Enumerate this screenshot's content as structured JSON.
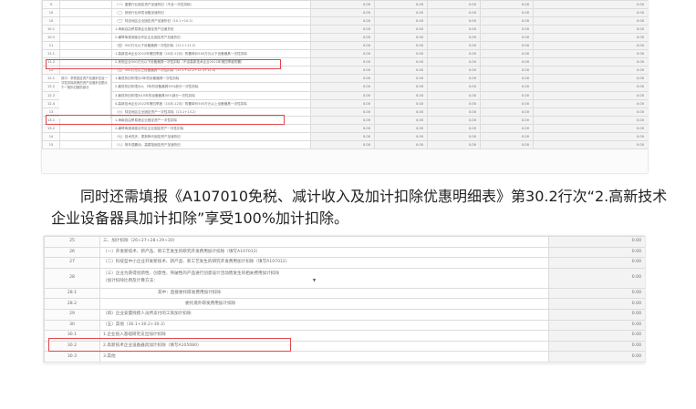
{
  "table1": {
    "merged_label": "其中：享受固定资产加速折旧及一次性扣除政策的资产加速折旧额大于一般折旧额的部分",
    "rows": [
      {
        "num": "9",
        "name": "（一）重要行业固定资产加速折旧（不含一次性扣除）",
        "v": [
          "0.00",
          "0.00",
          "0.00",
          "0.00",
          "0.00"
        ]
      },
      {
        "num": "10",
        "name": "（二）其他行业研发设备加速折旧",
        "v": [
          "0.00",
          "0.00",
          "0.00",
          "0.00",
          "0.00"
        ]
      },
      {
        "num": "10",
        "name": "（三）特定地区企业固定资产加速折旧（10.1+10.2）",
        "v": [
          "0.00",
          "0.00",
          "0.00",
          "0.00",
          "0.00"
        ]
      },
      {
        "num": "10.1",
        "name": "1.海南自由贸易港企业固定资产加速折旧",
        "v": [
          "0.00",
          "0.00",
          "0.00",
          "0.00",
          "0.00"
        ]
      },
      {
        "num": "10.2",
        "name": "2.横琴粤澳深度合作区企业固定资产加速折旧",
        "v": [
          "0.00",
          "0.00",
          "0.00",
          "0.00",
          "0.00"
        ]
      },
      {
        "num": "11",
        "name": "（四）500万元以下设备器具一次性扣除（11.1+11.2）",
        "v": [
          "0.00",
          "0.00",
          "0.00",
          "0.00",
          "0.00"
        ]
      },
      {
        "num": "11.1",
        "name": "1.高新技术企业2022年第四季度（10月-12月）购置单价500万元以下设备器具一次性扣除",
        "v": [
          "0.00",
          "0.00",
          "0.00",
          "0.00",
          "0.00"
        ]
      },
      {
        "num": "11.2",
        "name": "2.其他企业500万元以下设备器具一次性扣除（不含高新技术企业2022年第四季度购置）",
        "v": [
          "0.00",
          "0.00",
          "0.00",
          "0.00",
          "0.00"
        ]
      },
      {
        "num": "12",
        "name": "（五）500万元以上设备器具一次性扣除（12.1+12.2+12.3+12.4）",
        "v": [
          "0.00",
          "0.00",
          "0.00",
          "0.00",
          "0.00"
        ]
      },
      {
        "num": "12.1",
        "name": "1.最低折旧年限为3年的设备器具一次性扣除",
        "v": [
          "0.00",
          "0.00",
          "0.00",
          "0.00",
          "0.00"
        ]
      },
      {
        "num": "12.2",
        "name": "2.最低折旧年限为4、5年的设备器具50%部分一次性扣除",
        "v": [
          "0.00",
          "0.00",
          "0.00",
          "0.00",
          "0.00"
        ]
      },
      {
        "num": "12.3",
        "name": "3.最低折旧年限为10年的设备器具50%部分一次性扣除",
        "v": [
          "0.00",
          "0.00",
          "0.00",
          "0.00",
          "0.00"
        ]
      },
      {
        "num": "12.4",
        "name": "4.高新技术企业2022年第四季度（10月-12月）购置单价500万元以上设备器具一次性扣除",
        "v": [
          "0.00",
          "0.00",
          "0.00",
          "0.00",
          "0.00"
        ]
      },
      {
        "num": "13",
        "name": "（六）特定地区企业固定资产一次性扣除（13.1+13.2）",
        "v": [
          "0.00",
          "0.00",
          "0.00",
          "0.00",
          "0.00"
        ]
      },
      {
        "num": "13.1",
        "name": "1.海南自由贸易港企业固定资产一次性扣除",
        "v": [
          "0.00",
          "0.00",
          "0.00",
          "0.00",
          "0.00"
        ]
      },
      {
        "num": "13.2",
        "name": "2.横琴粤澳深度合作区企业固定资产一次性扣除",
        "v": [
          "0.00",
          "0.00",
          "0.00",
          "0.00",
          "0.00"
        ]
      },
      {
        "num": "14",
        "name": "（七）技术进步、更新换代固定资产加速折旧",
        "v": [
          "0.00",
          "0.00",
          "0.00",
          "0.00",
          "0.00"
        ]
      },
      {
        "num": "15",
        "name": "（八）常年强震动、高腐蚀固定资产加速折旧",
        "v": [
          "0.00",
          "0.00",
          "0.00",
          "0.00",
          "0.00"
        ]
      }
    ]
  },
  "paragraph": "同时还需填报《A107010免税、减计收入及加计扣除优惠明细表》第30.2行次“2.高新技术企业设备器具加计扣除”享受100%加计扣除。",
  "table2": {
    "rows": [
      {
        "num": "25",
        "name": "三、加计扣除（26+27+28+29+30）",
        "v": "0.00"
      },
      {
        "num": "26",
        "name": "（一）开发新技术、新产品、新工艺发生的研究开发费用加计扣除（填写A107012）",
        "v": "0.00"
      },
      {
        "num": "27",
        "name": "（二）科技型中小企业开发新技术、新产品、新工艺发生的研究开发费用加计扣除（填写A107012）",
        "v": "0.00"
      },
      {
        "num": "28",
        "name": "（三）企业为获得创新性、创意性、突破性的产品进行创意设计活动而发生的相关费用加计扣除",
        "v": "0.00"
      },
      {
        "num": "28.1",
        "name": "其中：直接委托研发费用加计扣除",
        "v": "0.00"
      },
      {
        "num": "28.2",
        "name": "委托境外研发费用加计扣除",
        "v": "0.00"
      },
      {
        "num": "29",
        "name": "（四）企业安置残疾人员所支付的工资加计扣除",
        "v": "0.00"
      },
      {
        "num": "30",
        "name": "（五）其他（30.1+30.2+30.3）",
        "v": "0.00"
      },
      {
        "num": "30.1",
        "name": "1.企业投入基础研究支出加计扣除",
        "v": "0.00"
      },
      {
        "num": "30.2",
        "name": "2.高新技术企业设备器具加计扣除（填写A105080）",
        "v": "0.00"
      },
      {
        "num": "30.3",
        "name": "3.其他",
        "v": "0.00"
      }
    ],
    "dropdown_label": "（加计扣除比例及计算方法：",
    "dropdown_arrow": "▼"
  },
  "colors": {
    "highlight": "#e0474c",
    "grid": "#dcdcdc",
    "value_bg": "#f3f3f3"
  }
}
